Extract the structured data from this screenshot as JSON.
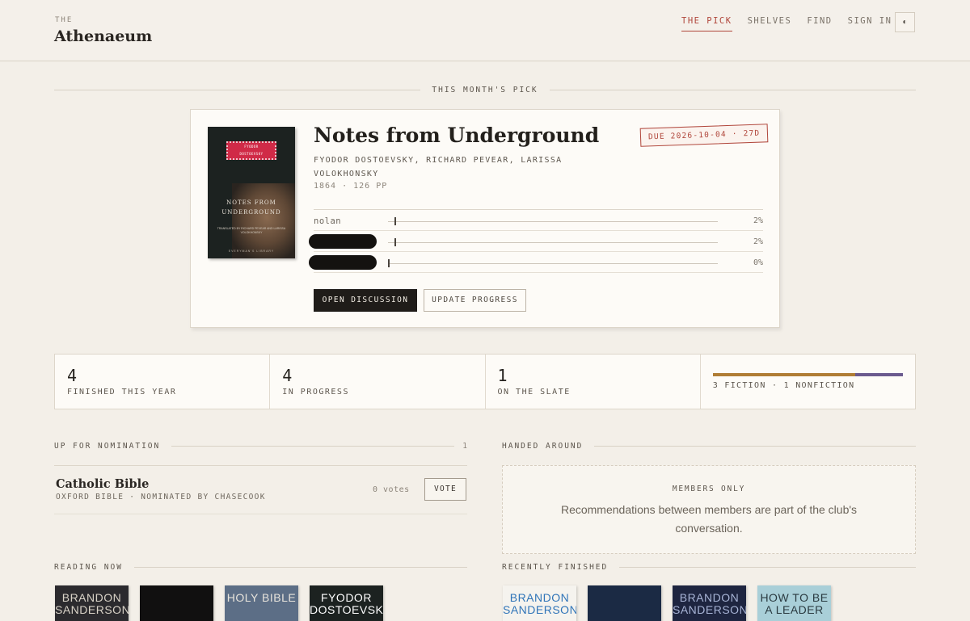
{
  "brand": {
    "the": "THE",
    "name": "Athenaeum"
  },
  "nav": {
    "items": [
      "THE PICK",
      "SHELVES",
      "FIND",
      "SIGN IN"
    ],
    "theme_icon": "◐"
  },
  "pick": {
    "section_title": "THIS MONTH'S PICK",
    "title": "Notes from Underground",
    "authors": "FYODOR DOSTOEVSKY, RICHARD PEVEAR, LARISSA VOLOKHONSKY",
    "meta": "1864 · 126 PP",
    "due": "DUE 2026-10-04 · 27D",
    "cover": {
      "label_top": "FYODOR",
      "label_bottom": "DOSTOEVSKY",
      "title_line1": "NOTES FROM",
      "title_line2": "UNDERGROUND",
      "subtitle": "TRANSLATED BY RICHARD PEVEAR AND LARISSA VOLOKHONSKY",
      "imprint": "EVERYMAN'S LIBRARY"
    },
    "progress": [
      {
        "name": "nolan",
        "value": "2%",
        "fraction": 0.02,
        "redacted": false
      },
      {
        "name": "",
        "value": "2%",
        "fraction": 0.02,
        "redacted": true
      },
      {
        "name": "",
        "value": "0%",
        "fraction": 0.0,
        "redacted": true
      }
    ],
    "open_discussion": "OPEN DISCUSSION",
    "update_progress": "UPDATE PROGRESS"
  },
  "stats": [
    {
      "num": "4",
      "label": "FINISHED THIS YEAR"
    },
    {
      "num": "4",
      "label": "IN PROGRESS"
    },
    {
      "num": "1",
      "label": "ON THE SLATE"
    }
  ],
  "split": {
    "label": "3 FICTION · 1 NONFICTION",
    "fiction_fraction": 0.75,
    "fiction_color": "#b07d35",
    "nonfiction_color": "#6b5a8e"
  },
  "nomination": {
    "title": "UP FOR NOMINATION",
    "count": "1",
    "item": {
      "title": "Catholic Bible",
      "sub": "OXFORD BIBLE · NOMINATED BY CHASECOOK",
      "votes": "0 votes",
      "vote_label": "VOTE"
    }
  },
  "handed": {
    "title": "HANDED AROUND",
    "members_title": "MEMBERS ONLY",
    "members_text": "Recommendations between members are part of the club's conversation."
  },
  "reading_now": {
    "title": "READING NOW",
    "books": [
      {
        "text": "BRANDON SANDERSON",
        "bg": "#2b2a2e",
        "fg": "#d9d3c8"
      },
      {
        "text": "",
        "bg": "#111010",
        "fg": "#c22a2a"
      },
      {
        "text": "HOLY BIBLE",
        "bg": "#5c6e86",
        "fg": "#e8e4dc"
      },
      {
        "text": "FYODOR DOSTOEVSKY",
        "bg": "#1c2220",
        "fg": "#ffffff"
      }
    ]
  },
  "recently_finished": {
    "title": "RECENTLY FINISHED",
    "books": [
      {
        "text": "BRANDON SANDERSON",
        "bg": "#f5f3ee",
        "fg": "#2f74b8"
      },
      {
        "text": "",
        "bg": "#1b2a44",
        "fg": "#f2c94c"
      },
      {
        "text": "BRANDON SANDERSON",
        "bg": "#1e2540",
        "fg": "#a8b4d6"
      },
      {
        "text": "HOW TO BE A LEADER",
        "bg": "#a9cfd8",
        "fg": "#2a3a40"
      }
    ]
  }
}
